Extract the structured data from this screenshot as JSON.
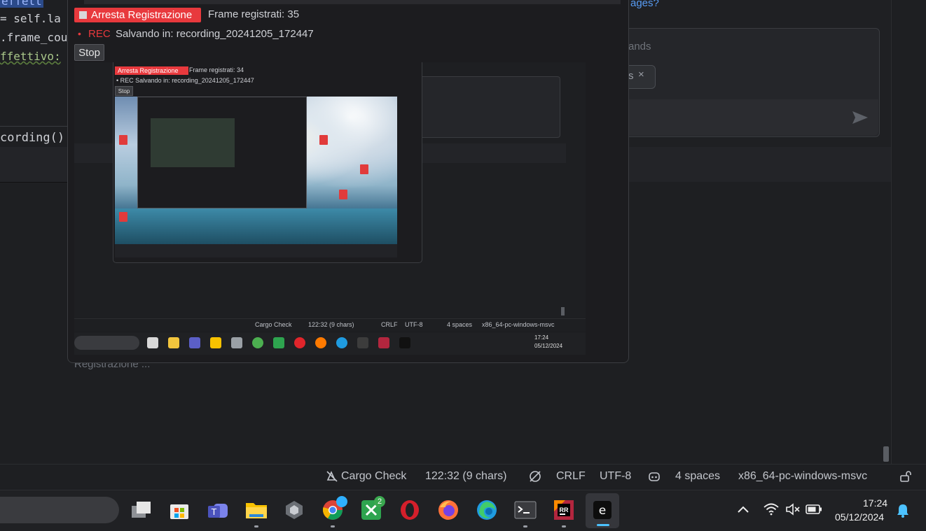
{
  "ide": {
    "code_lines": [
      {
        "text": "effett",
        "prefix": ""
      },
      {
        "text": "= self.la",
        "prefix": ""
      },
      {
        "text": ".frame_cou",
        "prefix": ""
      },
      {
        "text": "ffettivo:",
        "prefix": ""
      }
    ],
    "fragment_recording": "cording()",
    "under_text": "Registrazione ...",
    "right_panel": {
      "link_text": "ages?",
      "commands_text": "ands",
      "chip_label": "s",
      "chip_close": "×"
    }
  },
  "recorder": {
    "stop_recording_label": "Arresta Registrazione",
    "frames_text": "Frame registrati: 35",
    "rec_dot": "•",
    "rec_label": "REC",
    "saving_text": "Salvando in: recording_20241205_172447",
    "stop_label": "Stop"
  },
  "preview": {
    "stop_recording_label": "Arresta Registrazione",
    "frames_text": "Frame registrati: 34",
    "saving_text": "• REC  Salvando in: recording_20241205_172447",
    "stop_label": "Stop",
    "status": {
      "cargo": "Cargo Check",
      "position": "122:32 (9 chars)",
      "line_ending": "CRLF",
      "encoding": "UTF-8",
      "indent": "4 spaces",
      "target": "x86_64-pc-windows-msvc"
    },
    "clock_time": "17:24",
    "clock_date": "05/12/2024"
  },
  "statusbar": {
    "cargo": "Cargo Check",
    "position": "122:32 (9 chars)",
    "line_ending": "CRLF",
    "encoding": "UTF-8",
    "indent": "4 spaces",
    "target": "x86_64-pc-windows-msvc"
  },
  "taskbar": {
    "chrome_badge": "",
    "xbox_badge": "2",
    "active_app_letter": "e",
    "jetbrains_letters": "RR",
    "clock_time": "17:24",
    "clock_date": "05/12/2024"
  },
  "colors": {
    "record_red": "#e8393d",
    "accent_blue": "#4cc2ff",
    "background": "#1e1f22"
  }
}
